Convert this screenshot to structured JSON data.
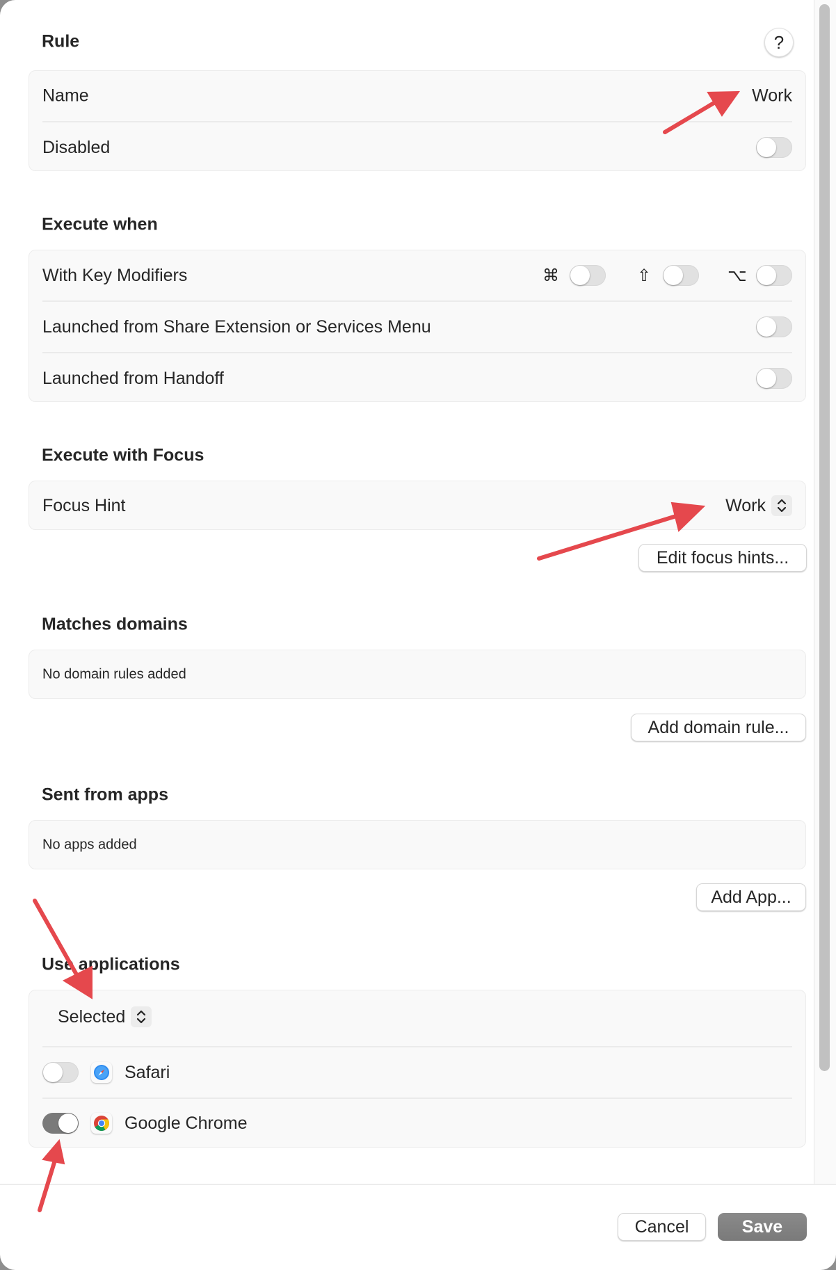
{
  "help_button": {
    "label": "?"
  },
  "sections": {
    "rule": {
      "title": "Rule",
      "name_label": "Name",
      "name_value": "Work",
      "disabled_label": "Disabled",
      "disabled_on": false
    },
    "execute_when": {
      "title": "Execute when",
      "key_modifiers_label": "With Key Modifiers",
      "modifiers": [
        {
          "symbol": "⌘",
          "icon": "command-icon",
          "on": false
        },
        {
          "symbol": "⇧",
          "icon": "shift-icon",
          "on": false
        },
        {
          "symbol": "⌥",
          "icon": "option-icon",
          "on": false
        }
      ],
      "share_extension_label": "Launched from Share Extension or Services Menu",
      "share_extension_on": false,
      "handoff_label": "Launched from Handoff",
      "handoff_on": false
    },
    "execute_with_focus": {
      "title": "Execute with Focus",
      "focus_hint_label": "Focus Hint",
      "focus_hint_value": "Work",
      "edit_button": "Edit focus hints..."
    },
    "matches_domains": {
      "title": "Matches domains",
      "empty_text": "No domain rules added",
      "add_button": "Add domain rule..."
    },
    "sent_from_apps": {
      "title": "Sent from apps",
      "empty_text": "No apps added",
      "add_button": "Add App..."
    },
    "use_applications": {
      "title": "Use applications",
      "mode_value": "Selected",
      "apps": [
        {
          "name": "Safari",
          "icon": "safari-icon",
          "on": false
        },
        {
          "name": "Google Chrome",
          "icon": "chrome-icon",
          "on": true
        }
      ]
    }
  },
  "footer": {
    "cancel_label": "Cancel",
    "save_label": "Save"
  },
  "colors": {
    "annotation_arrow": "#e5484d",
    "toggle_on": "#7a7a7a",
    "primary_button": "#828282"
  }
}
